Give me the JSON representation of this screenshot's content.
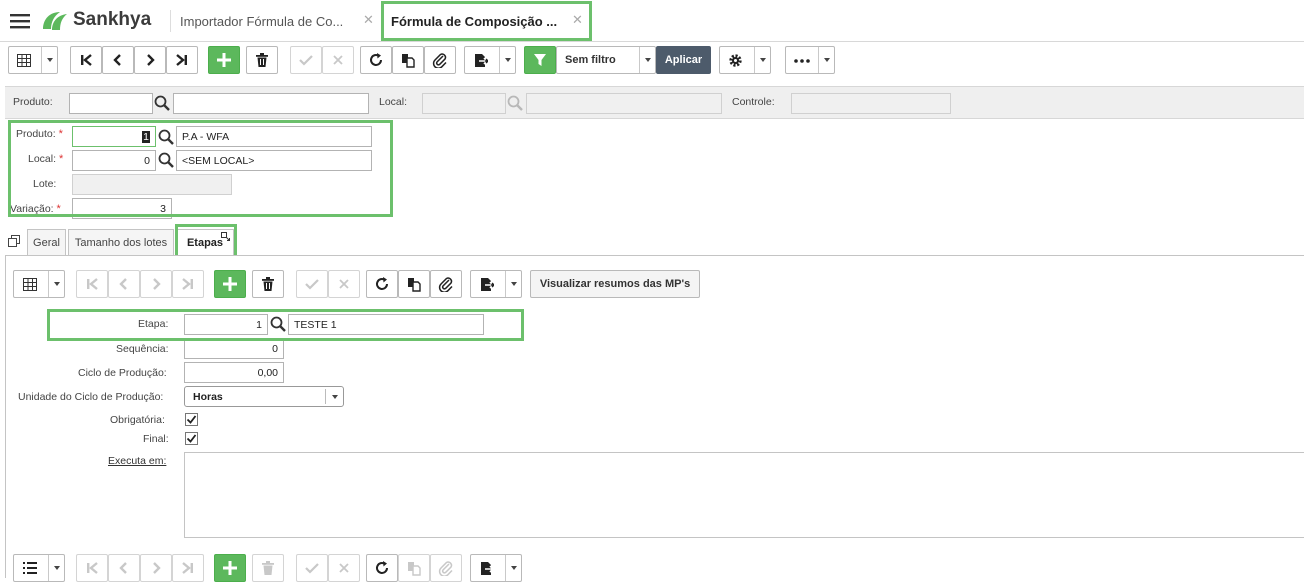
{
  "header": {
    "app_name": "Sankhya",
    "tabs": [
      {
        "label": "Importador Fórmula de Co..."
      },
      {
        "label": "Fórmula de Composição ..."
      }
    ],
    "close_glyph": "✕"
  },
  "toolbar": {
    "filter_label": "Sem filtro",
    "apply_label": "Aplicar"
  },
  "filter_bar": {
    "produto_label": "Produto:",
    "local_label": "Local:",
    "controle_label": "Controle:"
  },
  "form": {
    "produto_label": "Produto:",
    "produto_code": "1",
    "produto_desc": "P.A - WFA",
    "local_label": "Local:",
    "local_code": "0",
    "local_desc": "<SEM LOCAL>",
    "lote_label": "Lote:",
    "variacao_label": "Variação:",
    "variacao_value": "3",
    "required_mark": "*"
  },
  "subtabs": [
    {
      "label": "Geral"
    },
    {
      "label": "Tamanho dos lotes"
    },
    {
      "label": "Etapas"
    }
  ],
  "etapas": {
    "summary_button": "Visualizar resumos das MP's",
    "etapa_label": "Etapa:",
    "etapa_code": "1",
    "etapa_desc": "TESTE 1",
    "sequencia_label": "Sequência:",
    "sequencia_value": "0",
    "ciclo_label": "Ciclo de Produção:",
    "ciclo_value": "0,00",
    "unidade_label": "Unidade do Ciclo de Produção:",
    "unidade_value": "Horas",
    "obrigatoria_label": "Obrigatória:",
    "obrigatoria_checked": true,
    "final_label": "Final:",
    "final_checked": true,
    "executa_label": "Executa em:"
  },
  "colors": {
    "brand_green": "#5cb85c",
    "highlight": "#6cc06c",
    "apply_bg": "#4d5b6b"
  }
}
